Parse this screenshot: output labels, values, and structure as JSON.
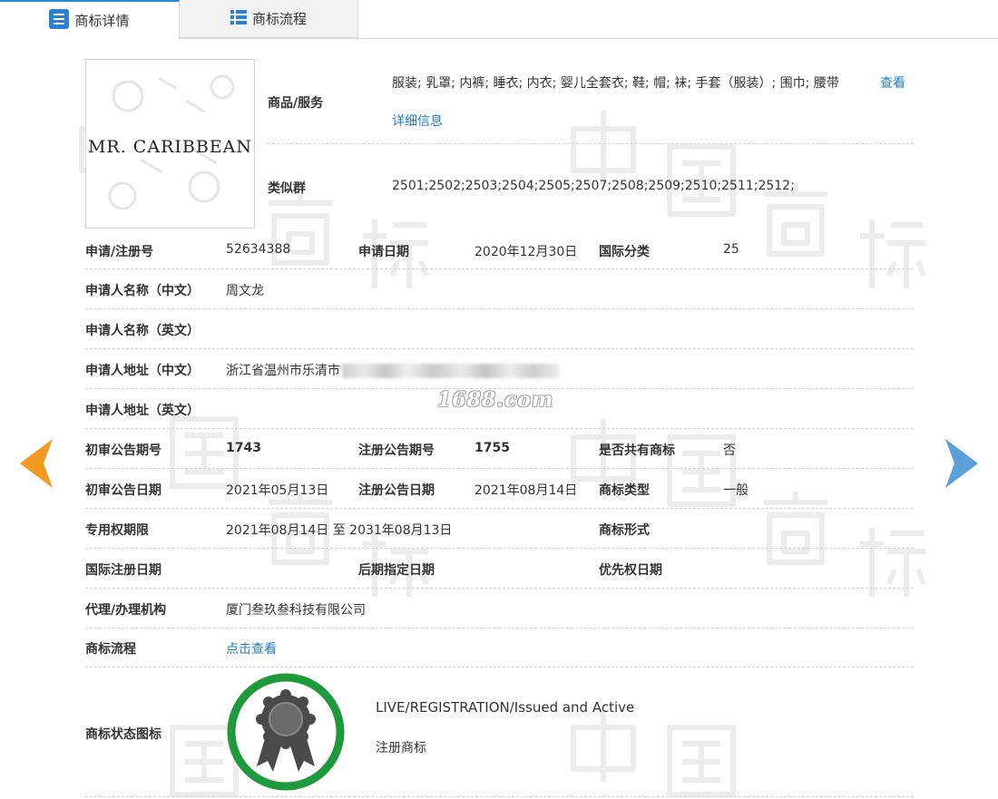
{
  "tabs": [
    {
      "label": "商标详情",
      "active": true,
      "icon": "list-icon"
    },
    {
      "label": "商标流程",
      "active": false,
      "icon": "grid-list-icon"
    }
  ],
  "logo": {
    "text": "MR. CARIBBEAN"
  },
  "goods": {
    "label": "商品/服务",
    "value": "服装; 乳罩; 内裤; 睡衣; 内衣; 婴儿全套衣; 鞋; 帽; 袜; 手套（服装）; 围巾; 腰带",
    "more_link": "查看",
    "more_link2": "详细信息"
  },
  "similar_group": {
    "label": "类似群",
    "value": "2501;2502;2503;2504;2505;2507;2508;2509;2510;2511;2512;"
  },
  "details": {
    "reg_no_label": "申请/注册号",
    "reg_no": "52634388",
    "apply_date_label": "申请日期",
    "apply_date": "2020年12月30日",
    "intl_class_label": "国际分类",
    "intl_class": "25",
    "applicant_cn_label": "申请人名称（中文）",
    "applicant_cn": "周文龙",
    "applicant_en_label": "申请人名称（英文）",
    "applicant_en": "",
    "address_cn_label": "申请人地址（中文）",
    "address_cn": "浙江省温州市乐清市",
    "address_en_label": "申请人地址（英文）",
    "address_en": "",
    "prelim_no_label": "初审公告期号",
    "prelim_no": "1743",
    "reg_pub_no_label": "注册公告期号",
    "reg_pub_no": "1755",
    "shared_label": "是否共有商标",
    "shared": "否",
    "prelim_date_label": "初审公告日期",
    "prelim_date": "2021年05月13日",
    "reg_pub_date_label": "注册公告日期",
    "reg_pub_date": "2021年08月14日",
    "tm_type_label": "商标类型",
    "tm_type": "一般",
    "exclusive_label": "专用权期限",
    "exclusive": "2021年08月14日 至 2031年08月13日",
    "tm_form_label": "商标形式",
    "tm_form": "",
    "intl_reg_date_label": "国际注册日期",
    "intl_reg_date": "",
    "later_date_label": "后期指定日期",
    "later_date": "",
    "priority_label": "优先权日期",
    "priority": "",
    "agent_label": "代理/办理机构",
    "agent": "厦门叁玖叁科技有限公司",
    "process_label": "商标流程",
    "process_link": "点击查看",
    "status_icon_label": "商标状态图标",
    "status_en": "LIVE/REGISTRATION/Issued and Active",
    "status_cn": "注册商标"
  },
  "watermark_text": "1688.com",
  "colors": {
    "accent": "#1f7fc4",
    "status_ring": "#1e9a3c",
    "prev_arrow": "#f29a21",
    "next_arrow": "#5aa0d9"
  }
}
